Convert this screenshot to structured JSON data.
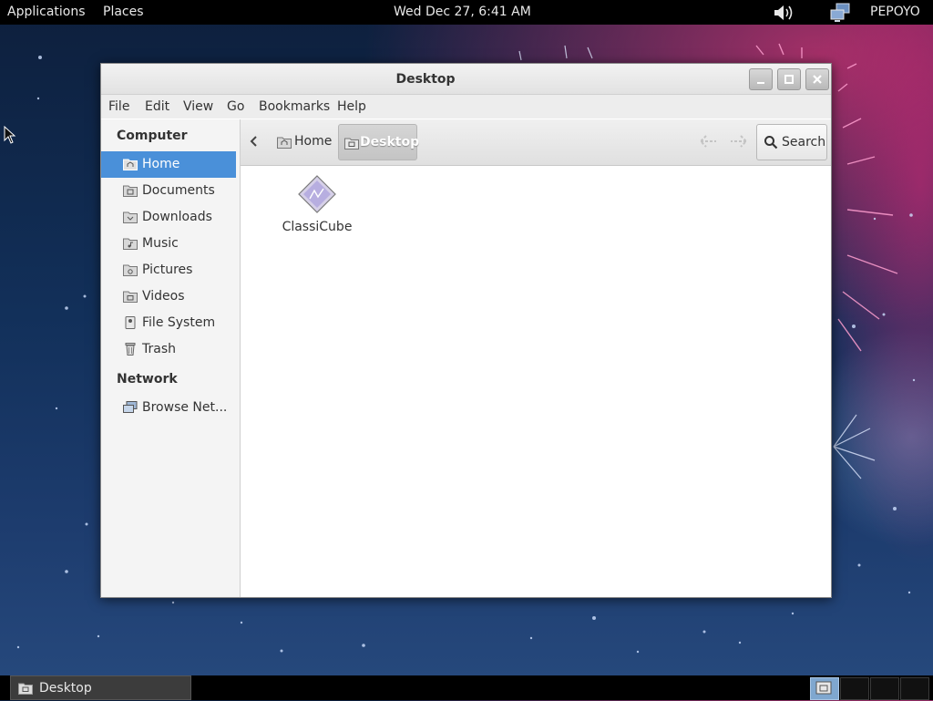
{
  "top_panel": {
    "applications_label": "Applications",
    "places_label": "Places",
    "clock": "Wed Dec 27,  6:41 AM",
    "user": "PEPOYO",
    "volume_icon": "speaker-icon",
    "network_icon": "network-icon"
  },
  "window": {
    "title": "Desktop",
    "buttons": [
      "minimize",
      "maximize",
      "close"
    ],
    "menu": [
      "File",
      "Edit",
      "View",
      "Go",
      "Bookmarks",
      "Help"
    ]
  },
  "sidebar": {
    "sections": [
      {
        "heading": "Computer",
        "items": [
          {
            "label": "Home",
            "icon": "home-folder-icon",
            "active": true
          },
          {
            "label": "Documents",
            "icon": "folder-icon"
          },
          {
            "label": "Downloads",
            "icon": "download-folder-icon"
          },
          {
            "label": "Music",
            "icon": "music-folder-icon"
          },
          {
            "label": "Pictures",
            "icon": "pictures-folder-icon"
          },
          {
            "label": "Videos",
            "icon": "videos-folder-icon"
          },
          {
            "label": "File System",
            "icon": "drive-icon"
          },
          {
            "label": "Trash",
            "icon": "trash-icon"
          }
        ]
      },
      {
        "heading": "Network",
        "items": [
          {
            "label": "Browse Net...",
            "icon": "network-icon"
          }
        ]
      }
    ]
  },
  "toolbar": {
    "breadcrumbs": [
      {
        "label": "Home",
        "current": false
      },
      {
        "label": "Desktop",
        "current": true
      }
    ],
    "search_label": "Search"
  },
  "content": {
    "files": [
      {
        "name": "ClassiCube",
        "icon": "application-diamond-icon"
      }
    ]
  },
  "bottom_panel": {
    "task_label": "Desktop",
    "workspaces": 4,
    "active_workspace": 1
  },
  "colors": {
    "selection": "#4a90d9",
    "panel": "#000000",
    "wallpaper_base": "#12305a",
    "wallpaper_accent": "#be326e"
  }
}
